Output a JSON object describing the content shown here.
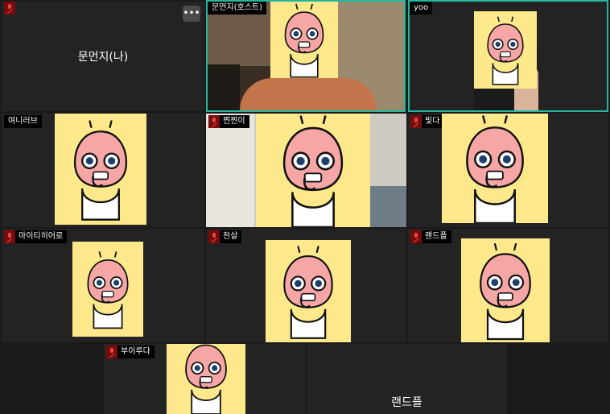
{
  "colors": {
    "accent": "#23b79e",
    "sticker_bg": "#fde98b",
    "muted_mic": "#7a0b0b",
    "tile_bg": "#232323"
  },
  "icons": {
    "mic": "mic-muted-icon",
    "more": "more-options-icon",
    "sticker": "peach-character-sticker"
  },
  "tiles": {
    "me": {
      "center_name": "문먼지(나)",
      "more_label": "•••"
    },
    "host": {
      "tag": "문먼지(호스트)"
    },
    "yoo": {
      "tag": "yoo"
    },
    "t4": {
      "tag": "여니러브"
    },
    "t5": {
      "tag": "찐찐이"
    },
    "t6": {
      "tag": "빛다"
    },
    "t7": {
      "tag": "마이티히어로"
    },
    "t8": {
      "tag": "천살"
    },
    "t9": {
      "tag": "랜드플"
    },
    "t10": {
      "tag": "부이루다"
    },
    "t11": {
      "center_name": "랜드플"
    }
  }
}
